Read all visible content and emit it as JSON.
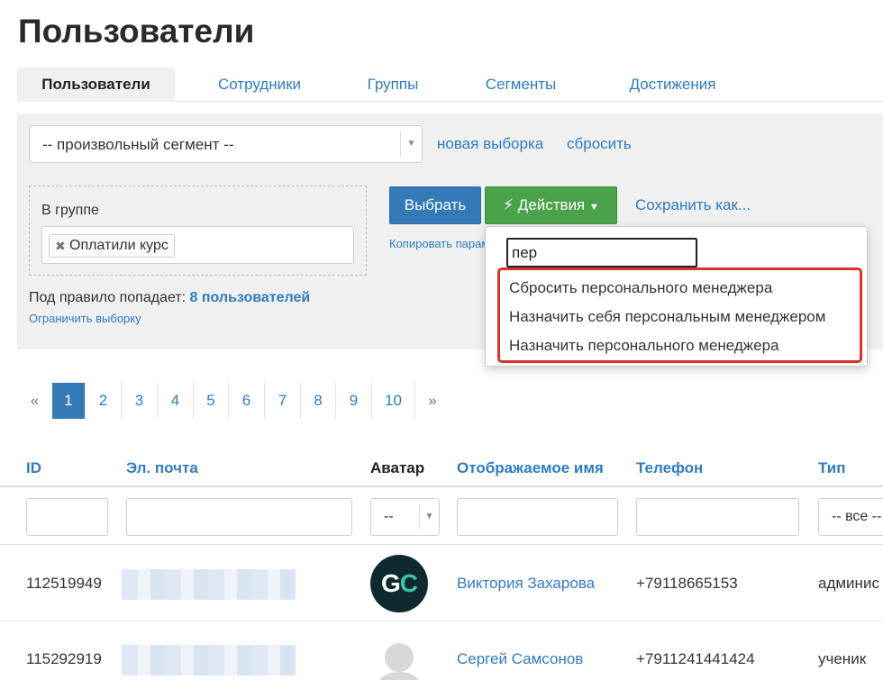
{
  "page": {
    "title": "Пользователи"
  },
  "tabs": [
    "Пользователи",
    "Сотрудники",
    "Группы",
    "Сегменты",
    "Достижения"
  ],
  "filter": {
    "segment_value": "-- произвольный сегмент --",
    "new_selection": "новая выборка",
    "reset": "сбросить",
    "rule_label": "В группе",
    "rule_tag": "Оплатили курс",
    "count_prefix": "Под правило попадает:",
    "count_value": "8 пользователей",
    "limit_link": "Ограничить выборку",
    "select_button": "Выбрать",
    "actions_button": "Действия",
    "save_as": "Сохранить как...",
    "copy_link": "Копировать параметры"
  },
  "actions_dropdown": {
    "search_value": "пер",
    "items": [
      "Сбросить персонального менеджера",
      "Назначить себя персональным менеджером",
      "Назначить персонального менеджера"
    ]
  },
  "pagination": {
    "prev": "«",
    "next": "»",
    "pages": [
      "1",
      "2",
      "3",
      "4",
      "5",
      "6",
      "7",
      "8",
      "9",
      "10"
    ],
    "current": "1"
  },
  "table": {
    "columns": [
      "ID",
      "Эл. почта",
      "Аватар",
      "Отображаемое имя",
      "Телефон",
      "Тип"
    ],
    "filters": {
      "avatar_select": "--",
      "type_select": "-- все --"
    },
    "rows": [
      {
        "id": "112519949",
        "name": "Виктория Захарова",
        "phone": "+79118665153",
        "type": "админис",
        "avatar": "GC"
      },
      {
        "id": "115292919",
        "name": "Сергей Самсонов",
        "phone": "+7911241441424",
        "type": "ученик",
        "avatar": ""
      }
    ]
  },
  "colors": {
    "accent": "#337ab7",
    "link": "#2f7cc0",
    "success": "#4aa34a",
    "highlight": "#d9312b"
  }
}
